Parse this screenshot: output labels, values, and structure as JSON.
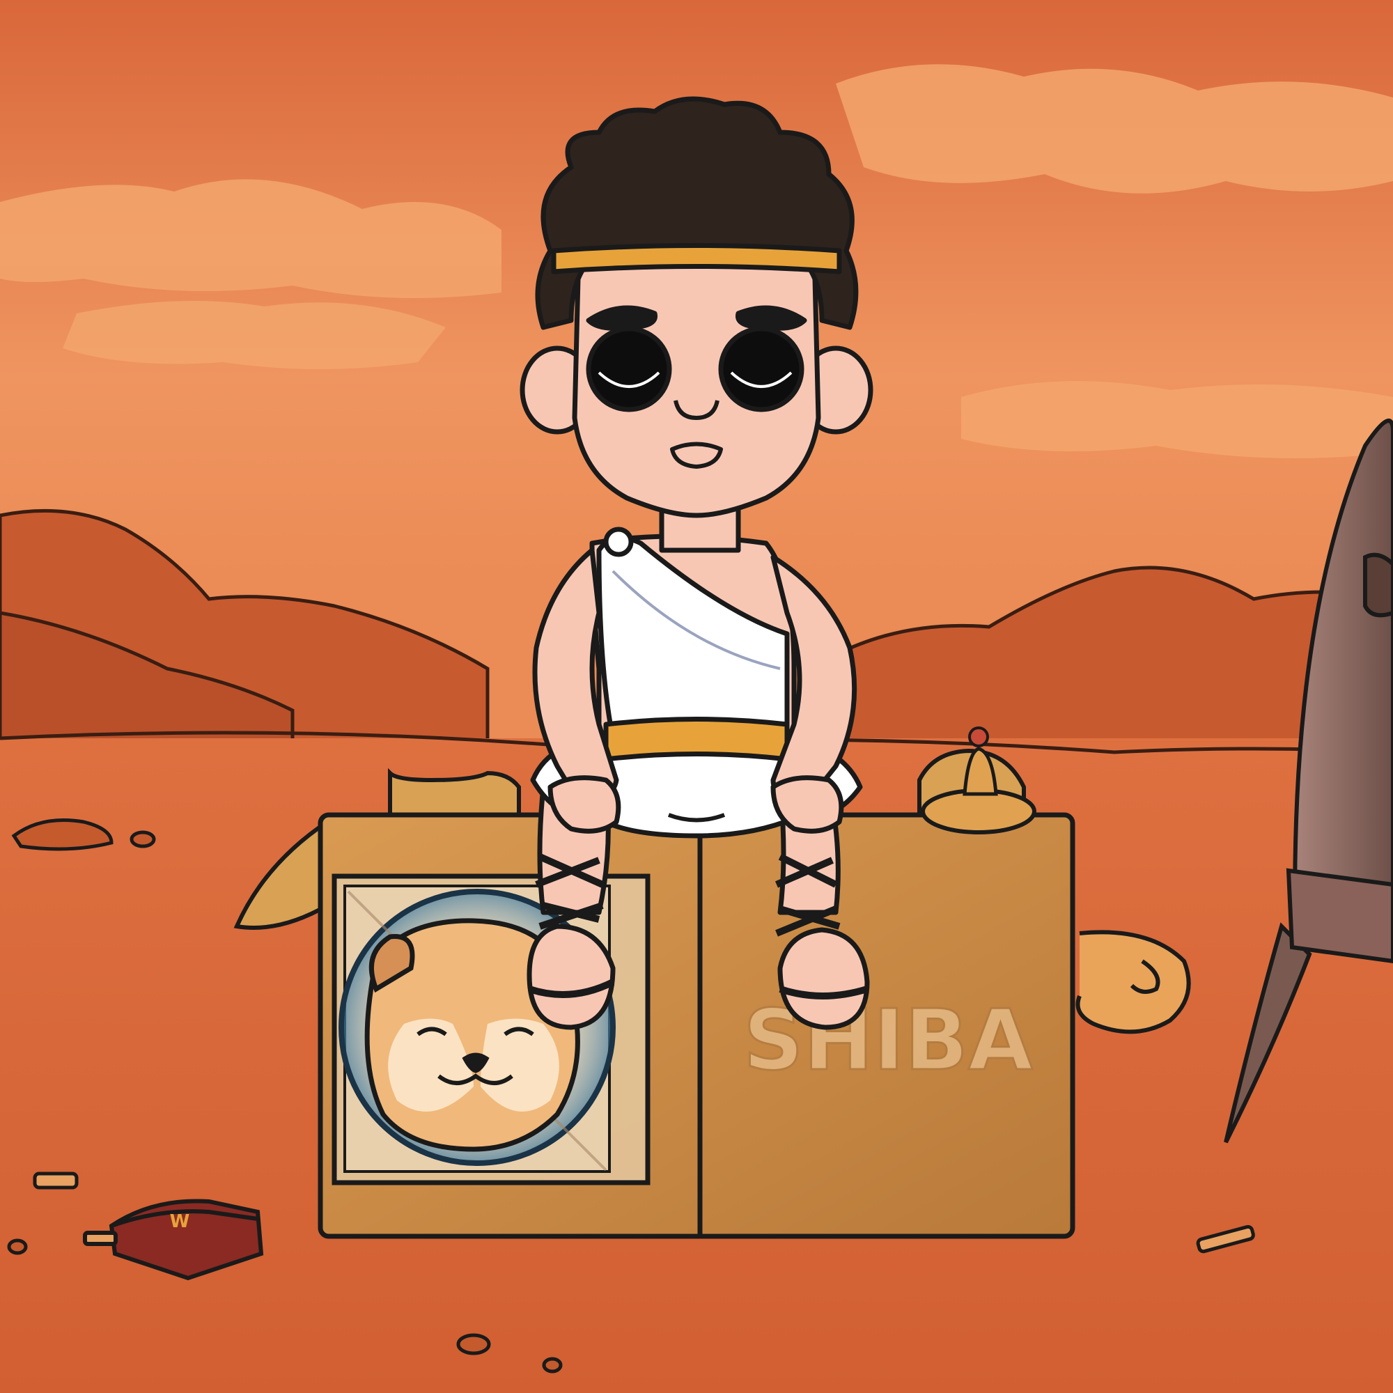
{
  "scene": {
    "box_label": "SHIBA",
    "chest_emblem": "W"
  },
  "colors": {
    "sky": "#e0753f",
    "sky_light": "#ef9a5e",
    "cloud": "#f4a56a",
    "hills": "#c9552b",
    "ground": "#dc6a3a",
    "box": "#c98d45",
    "box_edge": "#1a1a1a",
    "skin": "#f8c7b4",
    "hair": "#2e231d",
    "tunic": "#ffffff",
    "gold": "#e7a33a",
    "rocket": "#8d6a5c",
    "chest": "#8a2a23"
  }
}
